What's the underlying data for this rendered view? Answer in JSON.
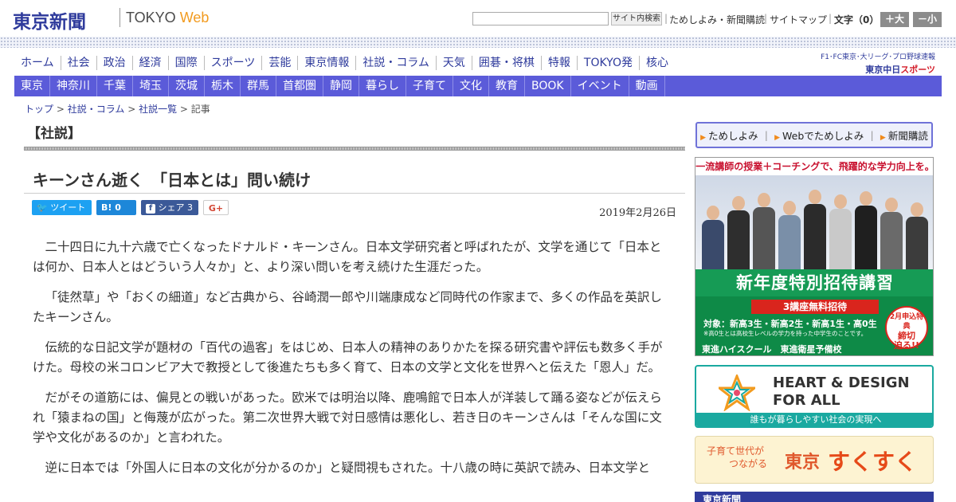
{
  "header": {
    "logo": "東京新聞",
    "sub_tokyo": "TOKYO",
    "sub_web": "Web",
    "search_button": "サイト内検索",
    "link_trial": "ためしよみ・新聞購読",
    "link_sitemap": "サイトマップ",
    "font_label": "文字（0）",
    "font_bigger": "＋大",
    "font_smaller": "－小"
  },
  "main_nav": [
    "ホーム",
    "社会",
    "政治",
    "経済",
    "国際",
    "スポーツ",
    "芸能",
    "東京情報",
    "社説・コラム",
    "天気",
    "囲碁・将棋",
    "特報",
    "TOKYO発",
    "核心"
  ],
  "sports_link": {
    "line1": "F1･FC東京･大リーグ･プロ野球速報",
    "line2_a": "東京中日",
    "line2_b": "スポーツ"
  },
  "sub_nav": [
    "東京",
    "神奈川",
    "千葉",
    "埼玉",
    "茨城",
    "栃木",
    "群馬",
    "首都圏",
    "静岡",
    "暮らし",
    "子育て",
    "文化",
    "教育",
    "BOOK",
    "イベント",
    "動画"
  ],
  "breadcrumb": [
    "トップ",
    "社説・コラム",
    "社説一覧",
    "記事"
  ],
  "article": {
    "section": "【社説】",
    "title": "キーンさん逝く　「日本とは」問い続け",
    "date": "2019年2月26日",
    "share": {
      "tweet": "ツイート",
      "hatena": "B! 0",
      "facebook": "シェア 3",
      "gplus": "G+"
    },
    "paragraphs": [
      "二十四日に九十六歳で亡くなったドナルド・キーンさん。日本文学研究者と呼ばれたが、文学を通じて「日本とは何か、日本人とはどういう人々か」と、より深い問いを考え続けた生涯だった。",
      "「徒然草」や「おくの細道」など古典から、谷崎潤一郎や川端康成など同時代の作家まで、多くの作品を英訳したキーンさん。",
      "伝統的な日記文学が題材の「百代の過客」をはじめ、日本人の精神のありかたを探る研究書や評伝も数多く手がけた。母校の米コロンビア大で教授として後進たちも多く育て、日本の文学と文化を世界へと伝えた「恩人」だ。",
      "だがその道筋には、偏見との戦いがあった。欧米では明治以降、鹿鳴館で日本人が洋装して踊る姿などが伝えられ「猿まねの国」と侮蔑が広がった。第二次世界大戦で対日感情は悪化し、若き日のキーンさんは「そんな国に文学や文化があるのか」と言われた。",
      "逆に日本では「外国人に日本の文化が分かるのか」と疑問視もされた。十八歳の時に英訳で読み、日本文学と"
    ]
  },
  "sidebar": {
    "promo": [
      "ためしよみ",
      "Webでためしよみ",
      "新聞購読"
    ],
    "ad_tosin": {
      "headline": "一流講師の授業＋コーチングで、飛躍的な学力向上を。",
      "banner": "新年度特別招待講習",
      "red": "3講座無料招待",
      "target": "対象：新高3生・新高2生・新高1生・高0生",
      "note": "※高0生とは高校生レベルの学力を持った中学生のことです。",
      "brand": "東進ハイスクール　東進衛星予備校",
      "circle_1": "2月申込特典",
      "circle_2": "締切",
      "circle_3": "迫る!!"
    },
    "ad_heart": {
      "line1": "HEART & DESIGN",
      "line2": "FOR ALL",
      "footer": "誰もが暮らしやすい社会の実現へ"
    },
    "ad_sukusuku": {
      "sub1": "子育て世代が",
      "sub2": "つながる",
      "big1": "東京",
      "big2": "すくすく"
    },
    "ad_bottom": "東京新聞"
  },
  "colors": {
    "brand": "#2f3b9c",
    "subnav": "#5b5bd9",
    "accent_orange": "#f29b1f",
    "ad_green": "#169b55",
    "heart_teal": "#1aa9a0"
  }
}
